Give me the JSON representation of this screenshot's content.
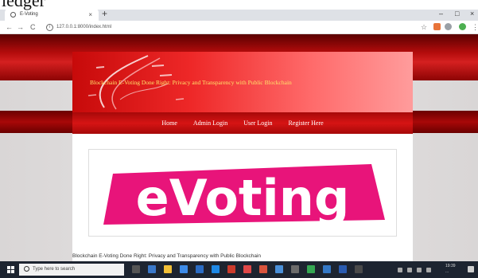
{
  "caption": "ledger",
  "browser": {
    "tab_title": "E-Voting",
    "tab_close": "×",
    "new_tab": "+",
    "minimize": "–",
    "maximize": "□",
    "close": "×",
    "back": "←",
    "forward": "→",
    "reload": "C",
    "info": "i",
    "url": "127.0.0.1:8000/index.html",
    "bookmark_star": "☆"
  },
  "site": {
    "header_title": "Blockchain E-Voting Done Right: Privacy and Transparency with Public Blockchain",
    "menu": [
      "Home",
      "Admin Login",
      "User Login",
      "Register Here"
    ],
    "logo_text": "eVoting",
    "logo_color": "#e8147a",
    "footer": "Blockchain E-Voting Done Right: Privacy and Transparency with Public Blockchain"
  },
  "taskbar": {
    "search_placeholder": "Type here to search",
    "time": "19:39",
    "date": "..."
  }
}
